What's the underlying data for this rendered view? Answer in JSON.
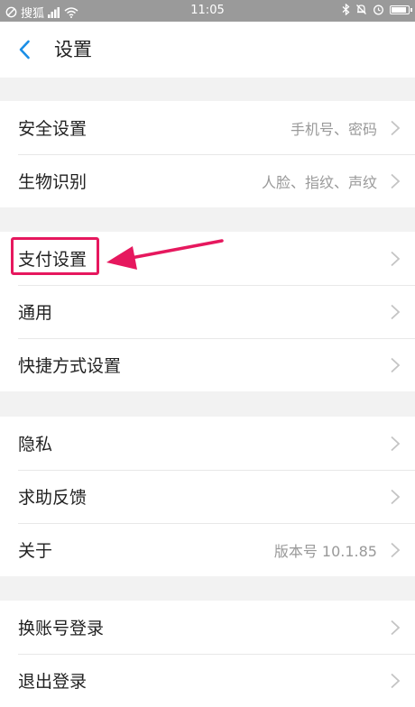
{
  "status_bar": {
    "carrier": "搜狐",
    "time": "11:05",
    "colors": {
      "background": "#9a9a9a"
    }
  },
  "header": {
    "title": "设置",
    "back_icon": "chevron-left-icon",
    "accent_color": "#1a8ee6"
  },
  "groups": [
    {
      "items": [
        {
          "label": "安全设置",
          "value": "手机号、密码"
        },
        {
          "label": "生物识别",
          "value": "人脸、指纹、声纹"
        }
      ]
    },
    {
      "items": [
        {
          "label": "支付设置",
          "value": ""
        },
        {
          "label": "通用",
          "value": ""
        },
        {
          "label": "快捷方式设置",
          "value": ""
        }
      ]
    },
    {
      "items": [
        {
          "label": "隐私",
          "value": ""
        },
        {
          "label": "求助反馈",
          "value": ""
        },
        {
          "label": "关于",
          "value": "版本号 10.1.85"
        }
      ]
    },
    {
      "items": [
        {
          "label": "换账号登录",
          "value": ""
        },
        {
          "label": "退出登录",
          "value": ""
        }
      ]
    }
  ],
  "annotation": {
    "highlight_color": "#e6185e",
    "target": "支付设置"
  }
}
